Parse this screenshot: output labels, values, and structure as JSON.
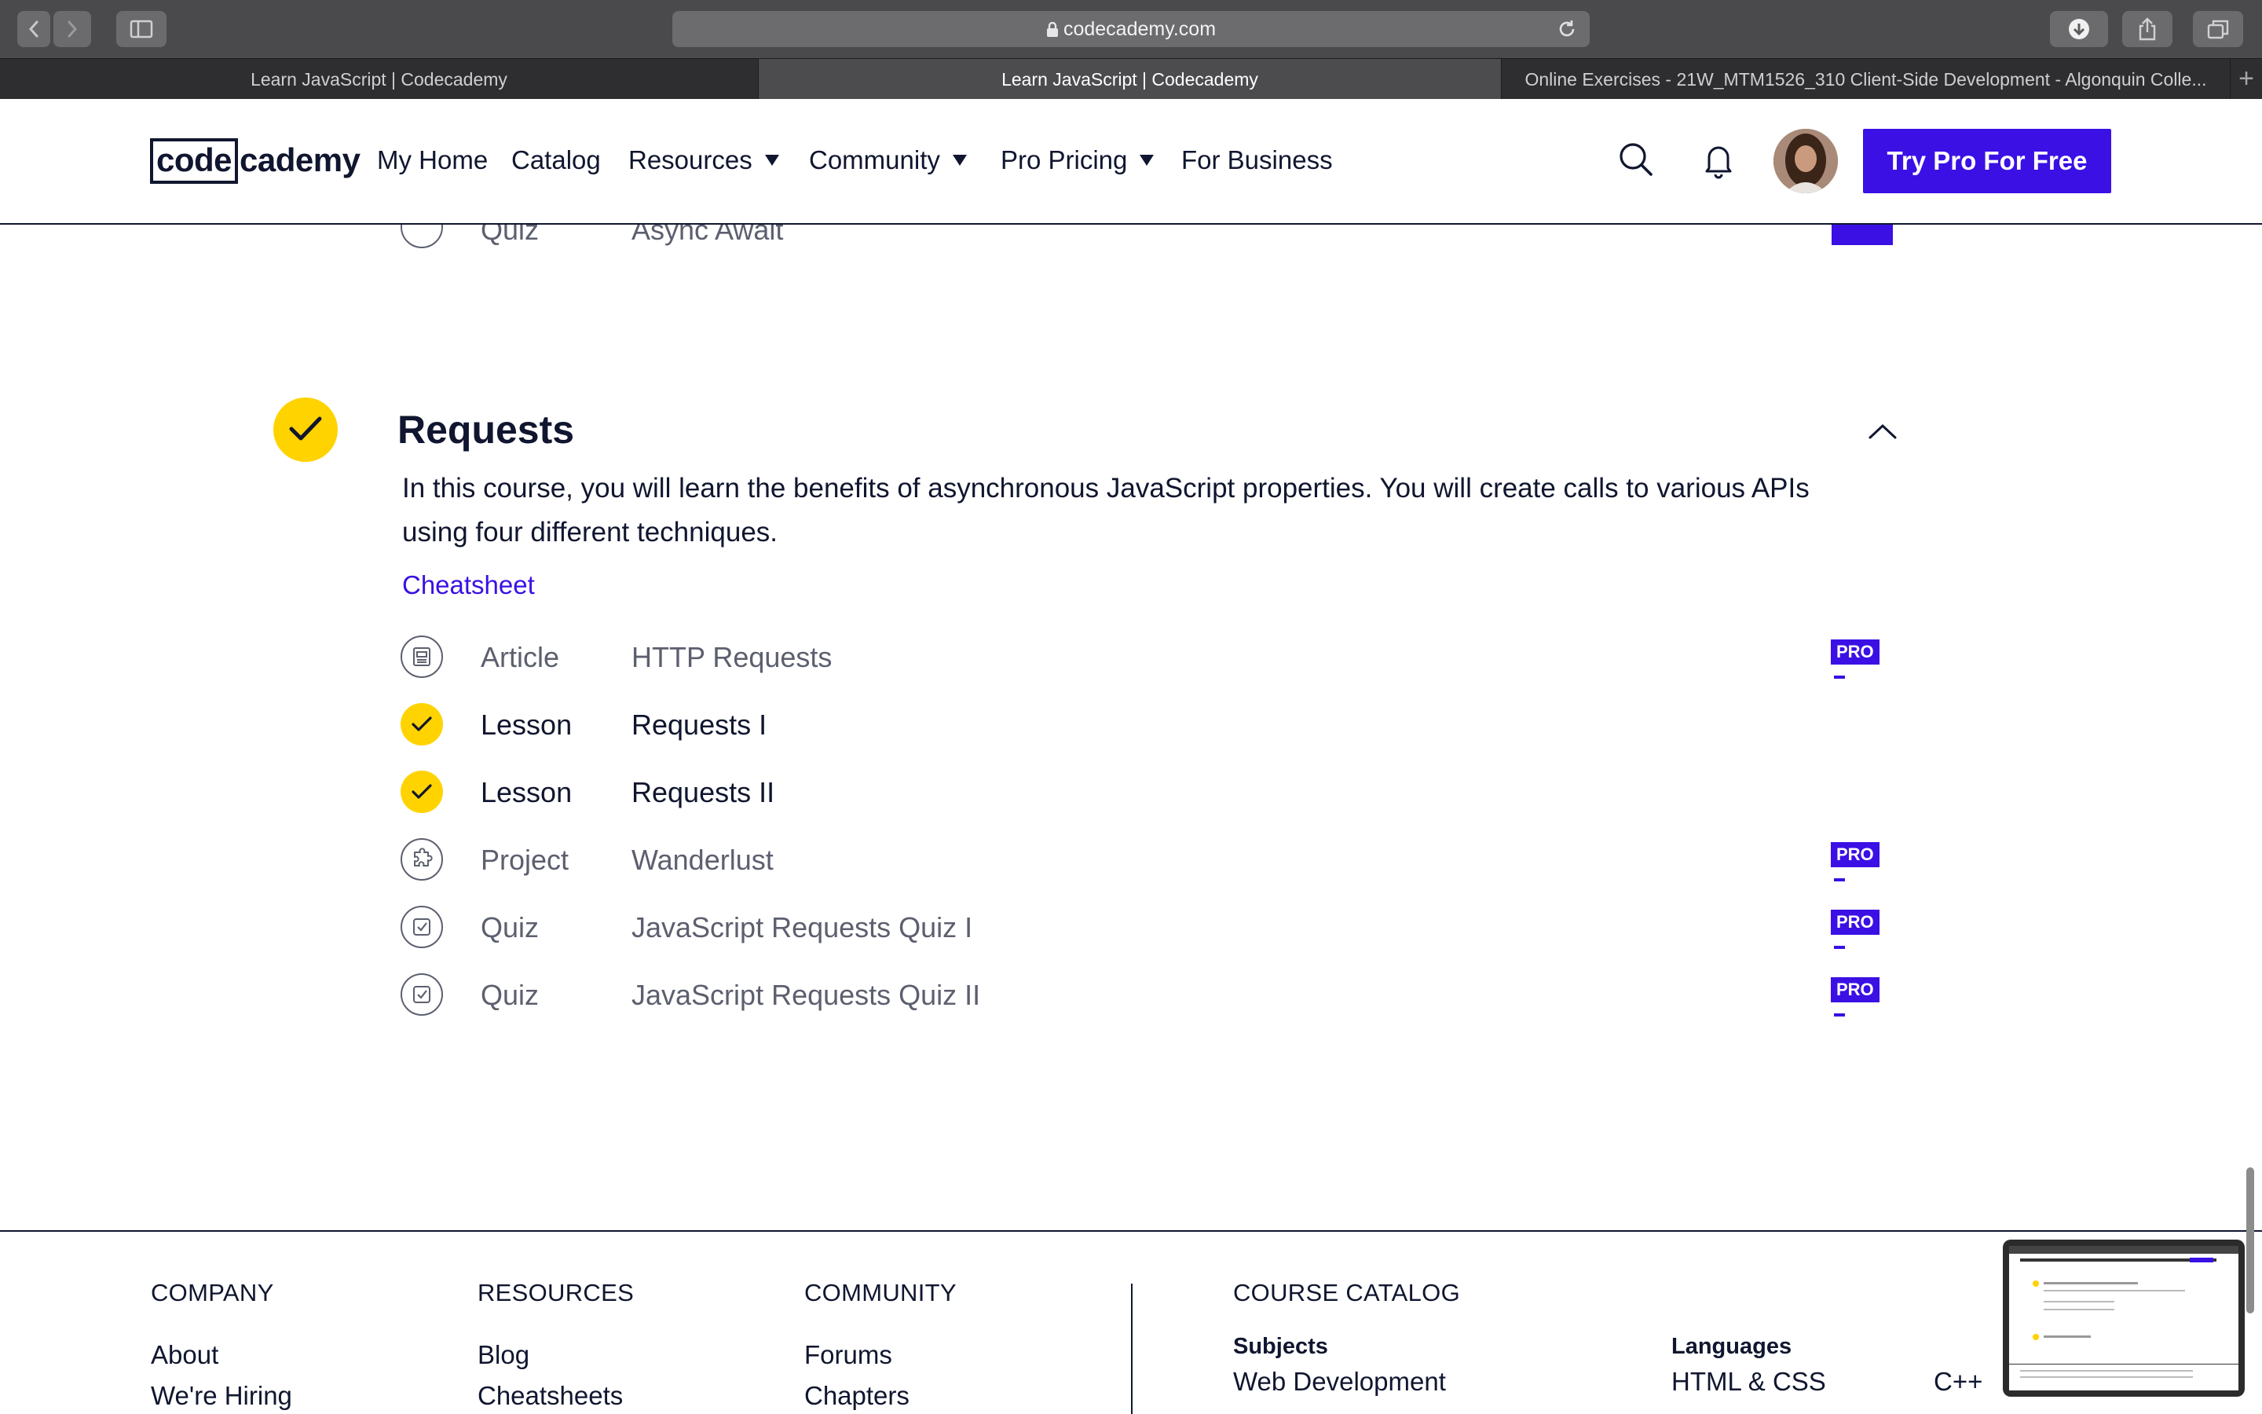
{
  "browser": {
    "url": "codecademy.com",
    "tabs": [
      {
        "label": "Learn JavaScript | Codecademy",
        "active": false
      },
      {
        "label": "Learn JavaScript | Codecademy",
        "active": true
      },
      {
        "label": "Online Exercises - 21W_MTM1526_310 Client-Side Development - Algonquin Colle...",
        "active": false
      }
    ],
    "new_tab": "+"
  },
  "header": {
    "logo_boxed": "code",
    "logo_rest": "cademy",
    "nav": [
      {
        "label": "My Home",
        "dropdown": false
      },
      {
        "label": "Catalog",
        "dropdown": false
      },
      {
        "label": "Resources",
        "dropdown": true
      },
      {
        "label": "Community",
        "dropdown": true
      },
      {
        "label": "Pro Pricing",
        "dropdown": true
      },
      {
        "label": "For Business",
        "dropdown": false
      }
    ],
    "cta": "Try Pro For Free"
  },
  "previous_row": {
    "type": "Quiz",
    "name": "Async Await"
  },
  "section": {
    "title": "Requests",
    "completed": true,
    "description": "In this course, you will learn the benefits of asynchronous JavaScript properties. You will create calls to various APIs using four different techniques.",
    "cheatsheet": "Cheatsheet",
    "items": [
      {
        "type": "Article",
        "name": "HTTP Requests",
        "icon": "article-icon",
        "completed": false,
        "pro": true
      },
      {
        "type": "Lesson",
        "name": "Requests I",
        "icon": "check-icon",
        "completed": true,
        "pro": false
      },
      {
        "type": "Lesson",
        "name": "Requests II",
        "icon": "check-icon",
        "completed": true,
        "pro": false
      },
      {
        "type": "Project",
        "name": "Wanderlust",
        "icon": "puzzle-icon",
        "completed": false,
        "pro": true
      },
      {
        "type": "Quiz",
        "name": "JavaScript Requests Quiz I",
        "icon": "quiz-icon",
        "completed": false,
        "pro": true
      },
      {
        "type": "Quiz",
        "name": "JavaScript Requests Quiz II",
        "icon": "quiz-icon",
        "completed": false,
        "pro": true
      }
    ],
    "pro_label": "PRO"
  },
  "footer": {
    "company": {
      "heading": "COMPANY",
      "links": [
        "About",
        "We're Hiring"
      ]
    },
    "resources": {
      "heading": "RESOURCES",
      "links": [
        "Blog",
        "Cheatsheets"
      ]
    },
    "community": {
      "heading": "COMMUNITY",
      "links": [
        "Forums",
        "Chapters"
      ]
    },
    "catalog": {
      "heading": "COURSE CATALOG",
      "subjects_heading": "Subjects",
      "subjects": [
        "Web Development"
      ],
      "languages_heading": "Languages",
      "languages": [
        "HTML & CSS",
        "C++"
      ]
    }
  },
  "colors": {
    "brand_navy": "#10162f",
    "accent_purple": "#3a10e5",
    "complete_yellow": "#ffd300",
    "muted_text": "#5c5f6e"
  }
}
